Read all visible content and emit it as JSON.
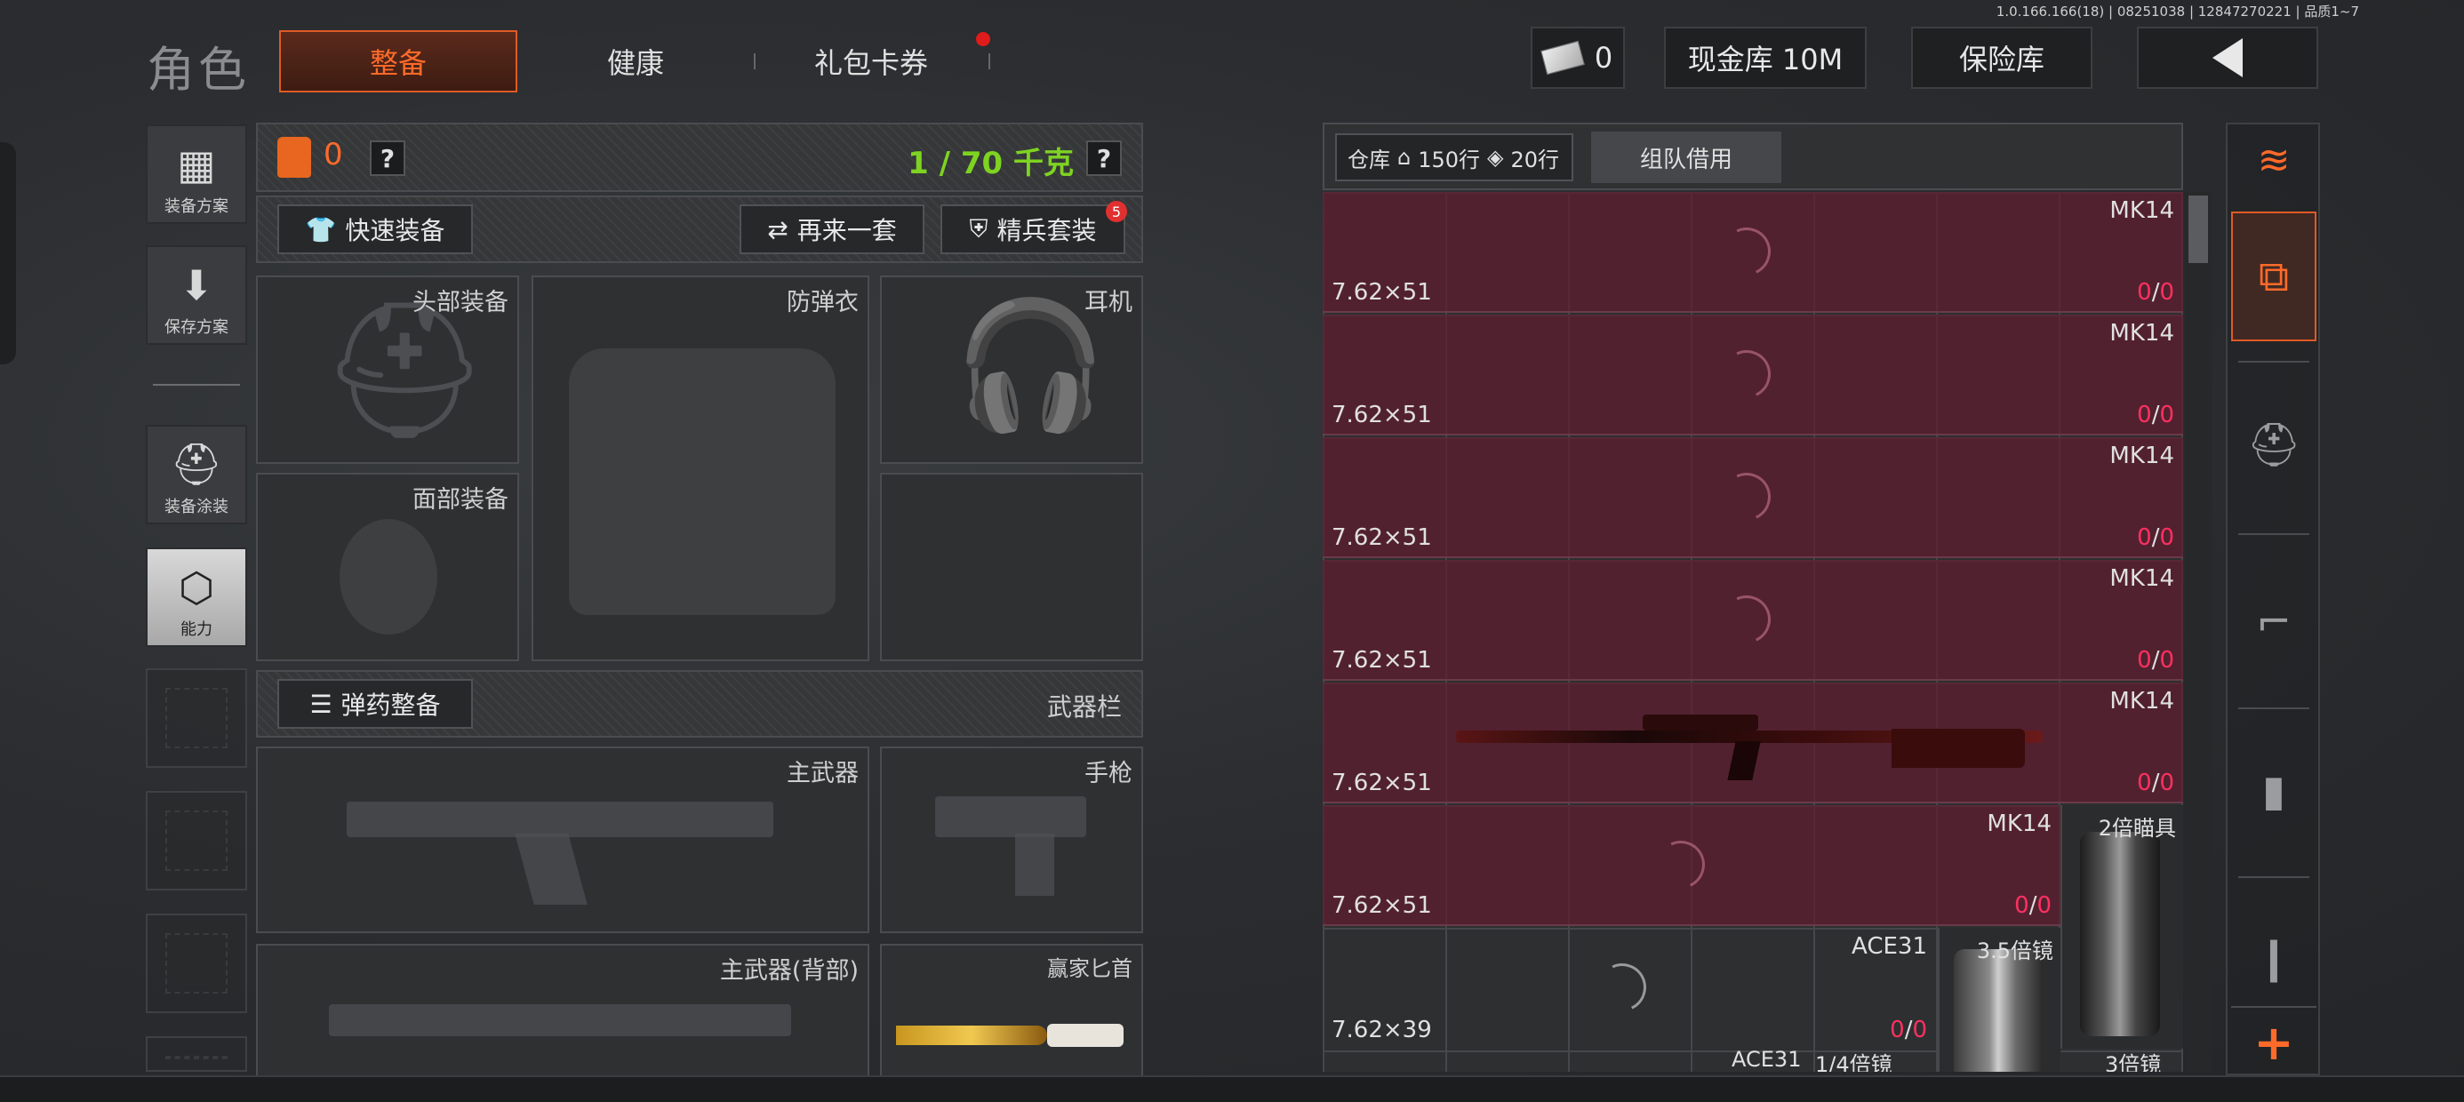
{
  "version": "1.0.166.166(18) | 08251038 | 12847270221 | 品质1~7",
  "header": {
    "title": "角色",
    "tabs": [
      {
        "label": "整备",
        "active": true
      },
      {
        "label": "健康",
        "active": false
      },
      {
        "label": "礼包卡券",
        "active": false,
        "notification": true
      }
    ],
    "cash_amount": "0",
    "cash_vault": "现金库 10M",
    "insurance": "保险库"
  },
  "sidebar": {
    "items": [
      {
        "label": "装备方案",
        "icon": "vest-icon"
      },
      {
        "label": "保存方案",
        "icon": "download-icon"
      },
      {
        "label": "装备涂装",
        "icon": "helmet-paint-icon"
      },
      {
        "label": "能力",
        "icon": "ability-hexagon-icon",
        "active": true
      }
    ]
  },
  "loadout": {
    "armor_count": "0",
    "weight": "1 / 70 千克",
    "quick_equip": "快速装备",
    "reroll": "再来一套",
    "elite_set": "精兵套装",
    "elite_badge": "5",
    "ammo_equip": "弹药整备",
    "weapon_bar": "武器栏",
    "slots": {
      "head": "头部装备",
      "armor": "防弹衣",
      "headset": "耳机",
      "face": "面部装备",
      "primary": "主武器",
      "pistol": "手枪",
      "primary_back": "主武器(背部)",
      "knife": "赢家匕首"
    }
  },
  "warehouse": {
    "label": "仓库",
    "rows_home": "150行",
    "rows_extra": "20行",
    "team_borrow": "组队借用",
    "ammo_rows": [
      {
        "caliber": "7.62×51",
        "gun": "MK14",
        "have": "0",
        "total": "0"
      },
      {
        "caliber": "7.62×51",
        "gun": "MK14",
        "have": "0",
        "total": "0"
      },
      {
        "caliber": "7.62×51",
        "gun": "MK14",
        "have": "0",
        "total": "0"
      },
      {
        "caliber": "7.62×51",
        "gun": "MK14",
        "have": "0",
        "total": "0"
      },
      {
        "caliber": "7.62×51",
        "gun": "MK14",
        "have": "0",
        "total": "0"
      },
      {
        "caliber": "7.62×51",
        "gun": "MK14",
        "have": "0",
        "total": "0"
      }
    ],
    "ace_row": {
      "caliber": "7.62×39",
      "gun": "ACE31",
      "have": "0",
      "total": "0"
    },
    "bottom_row_gun": "ACE31",
    "scopes": [
      "2倍瞄具",
      "3.5倍镜",
      "1/4倍镜",
      "3倍镜"
    ]
  },
  "colors": {
    "accent": "#ff6a2a",
    "weight_green": "#7ed321",
    "ammo_row": "#5f1e30",
    "count_red": "#ff3060"
  }
}
